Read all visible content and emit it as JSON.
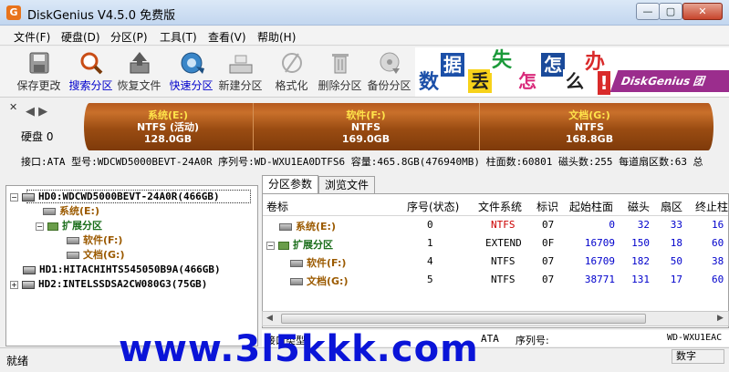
{
  "window": {
    "title": "DiskGenius V4.5.0 免费版",
    "app_icon": "G",
    "controls": {
      "minimize": "—",
      "maximize": "▢",
      "close": "✕"
    }
  },
  "menu": [
    "文件(F)",
    "硬盘(D)",
    "分区(P)",
    "工具(T)",
    "查看(V)",
    "帮助(H)"
  ],
  "toolbar": [
    {
      "label": "保存更改",
      "icon": "save-icon"
    },
    {
      "label": "搜索分区",
      "icon": "search-icon"
    },
    {
      "label": "恢复文件",
      "icon": "restore-icon"
    },
    {
      "label": "快速分区",
      "icon": "quick-partition-icon"
    },
    {
      "label": "新建分区",
      "icon": "new-partition-icon"
    },
    {
      "label": "格式化",
      "icon": "format-icon"
    },
    {
      "label": "删除分区",
      "icon": "delete-icon"
    },
    {
      "label": "备份分区",
      "icon": "backup-icon"
    }
  ],
  "banner": {
    "chars": [
      "数",
      "据",
      "丢",
      "失",
      "怎",
      "么",
      "办",
      "!"
    ],
    "tag": "DiskGenius 团"
  },
  "diskmap": {
    "disk_label": "硬盘 0",
    "nav": "◀ ▶",
    "close": "✕",
    "partitions": [
      {
        "name": "系统(E:)",
        "fs": "NTFS (活动)",
        "size": "128.0GB"
      },
      {
        "name": "软件(F:)",
        "fs": "NTFS",
        "size": "169.0GB"
      },
      {
        "name": "文档(G:)",
        "fs": "NTFS",
        "size": "168.8GB"
      }
    ]
  },
  "diskinfo": "接口:ATA  型号:WDCWD5000BEVT-24A0R  序列号:WD-WXU1EA0DTFS6  容量:465.8GB(476940MB)  柱面数:60801  磁头数:255  每道扇区数:63  总",
  "tree": {
    "hd0": "HD0:WDCWD5000BEVT-24A0R(466GB)",
    "sys": "系统(E:)",
    "ext": "扩展分区",
    "soft": "软件(F:)",
    "doc": "文档(G:)",
    "hd1": "HD1:HITACHIHTS545050B9A(466GB)",
    "hd2": "HD2:INTELSSDSA2CW080G3(75GB)"
  },
  "tabs": [
    "分区参数",
    "浏览文件"
  ],
  "table": {
    "headers": [
      "卷标",
      "序号(状态)",
      "文件系统",
      "标识",
      "起始柱面",
      "磁头",
      "扇区",
      "终止柱"
    ],
    "rows": [
      {
        "label": "系统(E:)",
        "seq": "0",
        "fs": "NTFS",
        "id": "07",
        "start": "0",
        "head": "32",
        "sector": "33",
        "end": "16"
      },
      {
        "label": "扩展分区",
        "seq": "1",
        "fs": "EXTEND",
        "id": "0F",
        "start": "16709",
        "head": "150",
        "sector": "18",
        "end": "60"
      },
      {
        "label": "软件(F:)",
        "seq": "4",
        "fs": "NTFS",
        "id": "07",
        "start": "16709",
        "head": "182",
        "sector": "50",
        "end": "38"
      },
      {
        "label": "文档(G:)",
        "seq": "5",
        "fs": "NTFS",
        "id": "07",
        "start": "38771",
        "head": "131",
        "sector": "17",
        "end": "60"
      }
    ]
  },
  "bottominfo": {
    "iface_label": "接口类型:",
    "iface": "ATA",
    "serial_label": "序列号:",
    "serial": "WD-WXU1EAC"
  },
  "status": {
    "left": "就绪",
    "right": "数字"
  },
  "watermark": "www.3l5kkk.com"
}
